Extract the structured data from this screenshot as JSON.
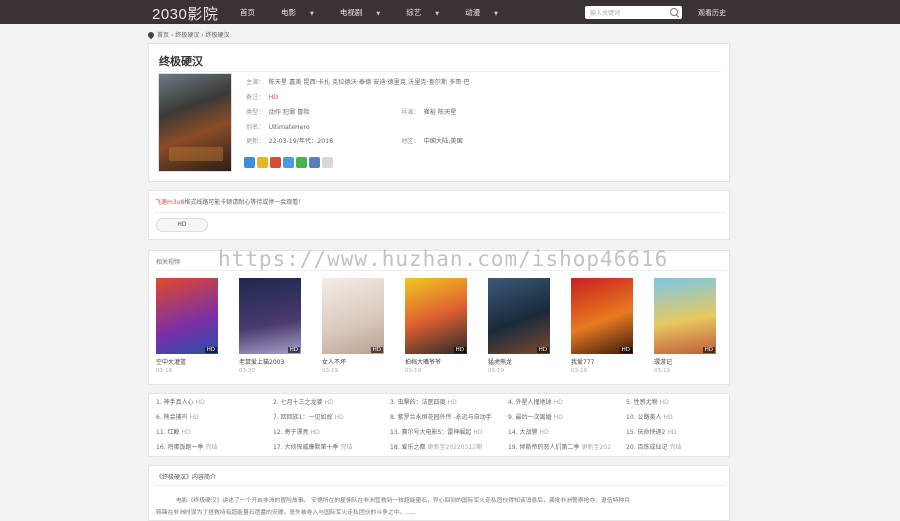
{
  "header": {
    "logo": "2030影院",
    "nav": [
      {
        "label": "首页",
        "dropdown": false
      },
      {
        "label": "电影",
        "dropdown": true
      },
      {
        "label": "电视剧",
        "dropdown": true
      },
      {
        "label": "综艺",
        "dropdown": true
      },
      {
        "label": "动漫",
        "dropdown": true
      }
    ],
    "search_placeholder": "输入关键词",
    "history": "观看历史"
  },
  "breadcrumb": {
    "home": "首页",
    "sep": "›",
    "category": "终极硬汉",
    "current": "终极硬汉"
  },
  "detail": {
    "title": "终极硬汉",
    "starring_label": "主演：",
    "starring": "陈天星 嘉美 昆西·卡扎 克拉德沃·泰德 安迪·德里克 沃里克·查尔斯 多哥·巴",
    "remark_label": "备注：",
    "remark": "HD",
    "genre_label": "类型：",
    "genre": "动作 犯罪 冒险",
    "director_label": "导演：",
    "director": "崔裕 陈天星",
    "alias_label": "别名：",
    "alias": "UltimateHero",
    "update_label": "更新：",
    "update": "22-03-19/年代：2016",
    "region_label": "地区：",
    "region": "中国大陆,美国"
  },
  "notice": {
    "highlight": "飞速m3u8",
    "text": "格式线路可能卡顿请耐心等待或停一会观看！",
    "source_button": "HD"
  },
  "related": {
    "heading": "相关视频",
    "movies": [
      {
        "name": "空中大灌篮",
        "date": "03-19",
        "badge": "HD"
      },
      {
        "name": "老鼠爱上猫2003",
        "date": "03-20",
        "badge": "HD"
      },
      {
        "name": "女人不坏",
        "date": "03-19",
        "badge": "HD"
      },
      {
        "name": "拍档大嘴爷爷",
        "date": "03-19",
        "badge": "HD"
      },
      {
        "name": "猛虎熊龙",
        "date": "03-19",
        "badge": "HD"
      },
      {
        "name": "我爱777",
        "date": "03-19",
        "badge": "HD"
      },
      {
        "name": "環游记",
        "date": "03-19",
        "badge": "HD"
      }
    ]
  },
  "ranking": [
    {
      "text": "1. 神手真人心",
      "q": "HD"
    },
    {
      "text": "2. 七月十三之龙婆",
      "q": "HD"
    },
    {
      "text": "3. 虫擊的：法医四度",
      "q": "HD"
    },
    {
      "text": "4. 外星人撞地球",
      "q": "HD"
    },
    {
      "text": "5. 性感尤物",
      "q": "HD"
    },
    {
      "text": "6. 熊会捕鸟",
      "q": "HD"
    },
    {
      "text": "7. 回回族1：一见如故",
      "q": "HD"
    },
    {
      "text": "8. 紫罗兰永恒花园外传 -永远与自动手",
      "q": ""
    },
    {
      "text": "9. 最后一次离婚",
      "q": "HD"
    },
    {
      "text": "10. 公路美人",
      "q": "HD"
    },
    {
      "text": "11. 红鲸",
      "q": "HD"
    },
    {
      "text": "12. 寄子漂亮",
      "q": "HD"
    },
    {
      "text": "13. 赛尔号大电影5：雷神崛起",
      "q": "HD"
    },
    {
      "text": "14. 大战警",
      "q": "HD"
    },
    {
      "text": "15. 玩命快递2",
      "q": "HD"
    },
    {
      "text": "16. 鸡蛋饭跑一季",
      "q": "完结"
    },
    {
      "text": "17. 大侦探威廉默第十季",
      "q": "完结"
    },
    {
      "text": "18. 爱乐之都",
      "q": "更新至20220312期"
    },
    {
      "text": "19. 倾斯帝的恶人们第二季",
      "q": "更新至202"
    },
    {
      "text": "20. 百炼成仙记",
      "q": "完结"
    }
  ],
  "intro": {
    "heading": "《终极硬汉》内容简介",
    "p1": "电影《终极硬汉》讲述了一个开启非洲的冒险故事。       安德所在的雇佣队在非洲营救到一枚超能量石，异心回到的国际军火走私团伙得知该消息后，袭批非洲警察抢夺。退伍特种兵",
    "p2": "韩锋在非洲时误为了拯救持有超能量石遗墓的安德，意外被卷入与国际军火走私团伙的斗争之中。......"
  },
  "watermark": "https://www.huzhan.com/ishop46616"
}
